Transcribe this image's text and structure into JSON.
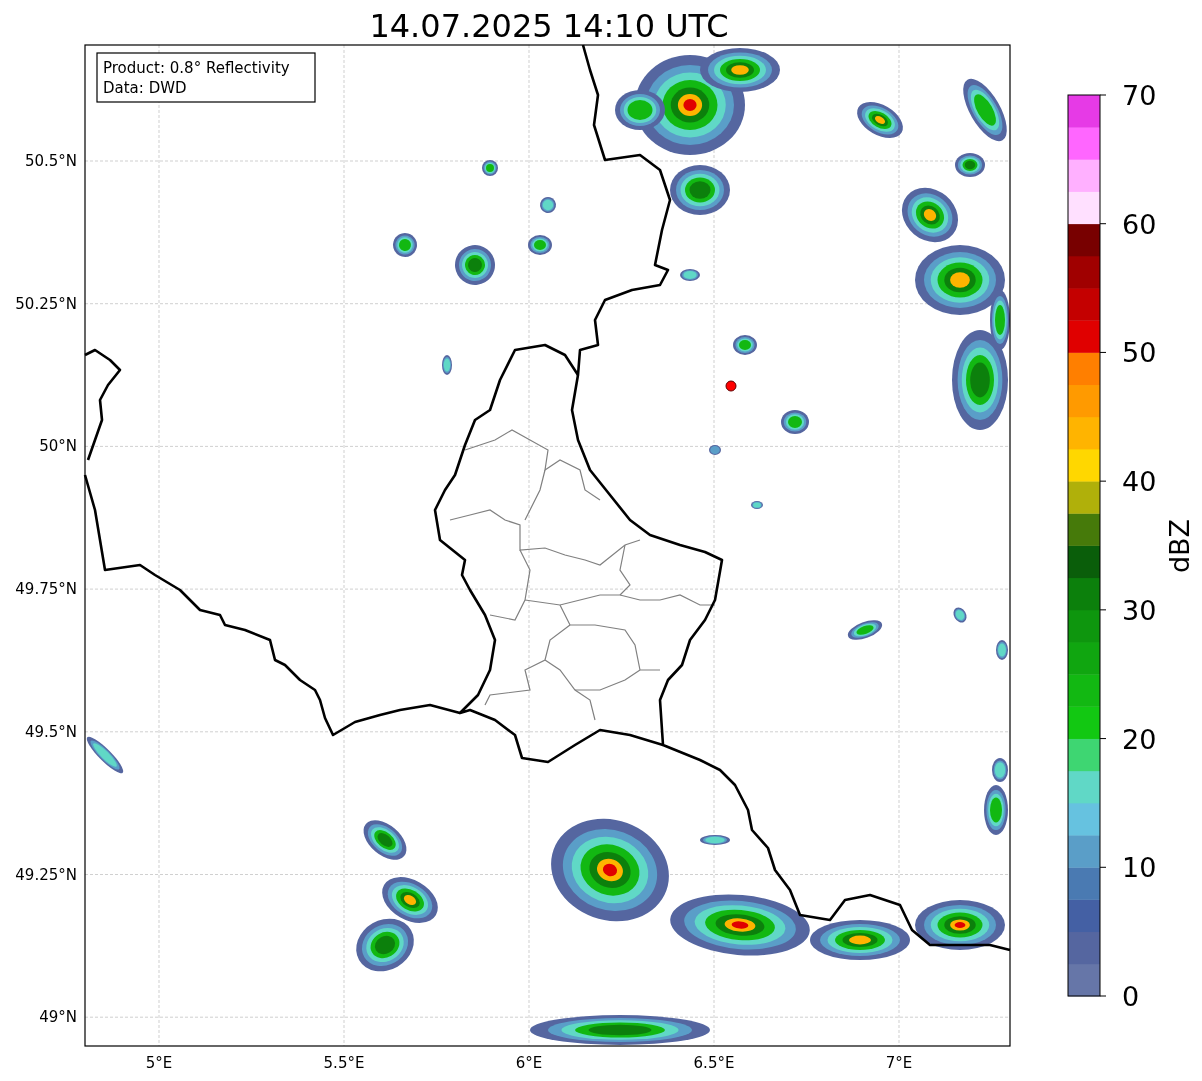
{
  "title": "14.07.2025 14:10 UTC",
  "info_box": [
    "Product: 0.8° Reflectivity",
    "Data: DWD"
  ],
  "map": {
    "lat_ticks": [
      "50.5°N",
      "50.25°N",
      "50°N",
      "49.75°N",
      "49.5°N",
      "49.25°N",
      "49°N"
    ],
    "lon_ticks": [
      "5°E",
      "5.5°E",
      "6°E",
      "6.5°E",
      "7°E"
    ]
  },
  "colorbar": {
    "label": "dBZ",
    "ticks": [
      "70",
      "60",
      "50",
      "40",
      "30",
      "20",
      "10",
      "0"
    ],
    "segments": [
      {
        "color": "#6676a8"
      },
      {
        "color": "#5566a0"
      },
      {
        "color": "#4460a4"
      },
      {
        "color": "#4a7ab2"
      },
      {
        "color": "#5a9ec8"
      },
      {
        "color": "#66c2e0"
      },
      {
        "color": "#60d8c6"
      },
      {
        "color": "#3ed672"
      },
      {
        "color": "#12c812"
      },
      {
        "color": "#12b812"
      },
      {
        "color": "#10a610"
      },
      {
        "color": "#0e960e"
      },
      {
        "color": "#0c800c"
      },
      {
        "color": "#0a5e0a"
      },
      {
        "color": "#467a0a"
      },
      {
        "color": "#b0b00a"
      },
      {
        "color": "#ffd700"
      },
      {
        "color": "#ffb400"
      },
      {
        "color": "#ff9a00"
      },
      {
        "color": "#ff7f00"
      },
      {
        "color": "#e00000"
      },
      {
        "color": "#c40000"
      },
      {
        "color": "#a00000"
      },
      {
        "color": "#780000"
      },
      {
        "color": "#ffe0ff"
      },
      {
        "color": "#ffb0ff"
      },
      {
        "color": "#ff66ff"
      },
      {
        "color": "#e63ae6"
      }
    ]
  }
}
